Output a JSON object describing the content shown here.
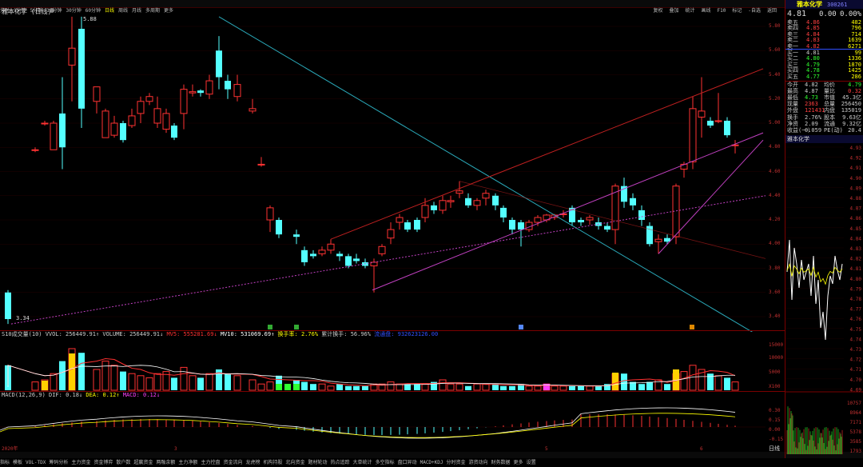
{
  "toolbar": {
    "items": [
      "分时",
      "1分钟",
      "5分钟",
      "15分钟",
      "30分钟",
      "60分钟",
      "日线",
      "周线",
      "月线",
      "多周期",
      "更多"
    ],
    "active_index": 6,
    "right_items": [
      "复权",
      "叠加",
      "统计",
      "画线",
      "F10",
      "标记",
      "-自选",
      "返回"
    ]
  },
  "chart_title": "雅本化学 (日线)",
  "price_axis": [
    "5.80",
    "5.60",
    "5.40",
    "5.20",
    "5.00",
    "4.80",
    "4.60",
    "4.40",
    "4.20",
    "4.00",
    "3.80",
    "3.60",
    "3.40"
  ],
  "high_label": "5.88",
  "low_label": "3.34",
  "volume_legend": {
    "prefix": "S10成交量(10) VVOL: 256449.91↑ VOLUME: 256449.91↓",
    "mv5": "MV5: 555281.69↓",
    "mv10": "MV10: 531069.69↑",
    "turnover": "换手率: 2.76%",
    "cum_turnover": "累计换手: 56.96%",
    "extra": "流通盘: 932623126.00"
  },
  "volume_axis": [
    "15000",
    "10000",
    "5000",
    "X100"
  ],
  "macd_legend": {
    "prefix": "MACD(12,26,9) DIF: 0.18↓",
    "dea": "DEA: 0.12↑",
    "macd": "MACD: 0.12↓"
  },
  "macd_axis": [
    "0.30",
    "0.15",
    "0.00",
    "-0.15"
  ],
  "x_axis": [
    "2020年",
    "3",
    "5",
    "6"
  ],
  "bottom_tabs": [
    "指标",
    "模板",
    "VOL-TDX",
    "筹码分析",
    "主力资金",
    "资金博弈",
    "散户数",
    "超赢资金",
    "两融余额",
    "主力净额",
    "主力控盘",
    "资金流向",
    "龙虎榜",
    "机构持股",
    "北向资金",
    "题材轮动",
    "热点追踪",
    "大单统计",
    "多空指标",
    "盘口异动",
    "MACD+KDJ",
    "分时资金",
    "游资动向",
    "财务数据",
    "更多",
    "设置"
  ],
  "bottom_active": "MACD",
  "bottom_right": "日线",
  "stock": {
    "name": "雅本化学",
    "code": "300261",
    "price": "4.81",
    "change": "0.00",
    "pct": "0.00%"
  },
  "sells": [
    {
      "label": "卖五",
      "price": "4.86",
      "vol": "482"
    },
    {
      "label": "卖四",
      "price": "4.85",
      "vol": "796"
    },
    {
      "label": "卖三",
      "price": "4.84",
      "vol": "714"
    },
    {
      "label": "卖二",
      "price": "4.83",
      "vol": "1639"
    },
    {
      "label": "卖一",
      "price": "4.82",
      "vol": "6271"
    }
  ],
  "buys": [
    {
      "label": "买一",
      "price": "4.81",
      "vol": "99"
    },
    {
      "label": "买二",
      "price": "4.80",
      "vol": "1336"
    },
    {
      "label": "买三",
      "price": "4.79",
      "vol": "1870"
    },
    {
      "label": "买四",
      "price": "4.78",
      "vol": "1425"
    },
    {
      "label": "买五",
      "price": "4.77",
      "vol": "286"
    }
  ],
  "stats": [
    {
      "l1": "今开",
      "v1": "4.82",
      "l2": "均价",
      "v2": "4.79"
    },
    {
      "l1": "最高",
      "v1": "4.87",
      "l2": "量比",
      "v2": "0.32"
    },
    {
      "l1": "最低",
      "v1": "4.73",
      "l2": "市值",
      "v2": "45.3亿"
    },
    {
      "l1": "现量",
      "v1": "2363",
      "l2": "总量",
      "v2": "256450"
    },
    {
      "l1": "外盘",
      "v1": "121431",
      "l2": "内盘",
      "v2": "135019"
    },
    {
      "l1": "换手",
      "v1": "2.76%",
      "l2": "股本",
      "v2": "9.63亿"
    },
    {
      "l1": "净资",
      "v1": "2.09",
      "l2": "流通",
      "v2": "9.32亿"
    },
    {
      "l1": "收益(一)",
      "v1": "0.059",
      "l2": "PE(动)",
      "v2": "20.4"
    }
  ],
  "mini_title": "雅本化学",
  "mini_axis": [
    "4.93",
    "4.92",
    "4.91",
    "4.90",
    "4.89",
    "4.88",
    "4.87",
    "4.86",
    "4.85",
    "4.84",
    "4.83",
    "4.82",
    "4.81",
    "4.80",
    "4.79",
    "4.78",
    "4.77",
    "4.76",
    "4.75",
    "4.74",
    "4.73",
    "4.72",
    "4.71",
    "4.70",
    "4.69"
  ],
  "mini_vol_axis": [
    "10757",
    "8964",
    "7171",
    "5378",
    "3585",
    "1793"
  ]
}
